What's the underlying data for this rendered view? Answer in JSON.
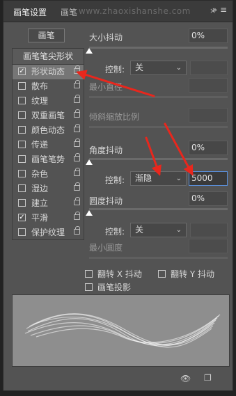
{
  "tabs": [
    {
      "label": "画笔设置",
      "active": true
    },
    {
      "label": "画笔",
      "active": false
    }
  ],
  "title_controls": "»  ≡",
  "tab_close": "×",
  "watermark": "www.zhaoxishanshe.com",
  "brush_button": "画笔",
  "brush_tip_shape": "画笔笔尖形状",
  "options": [
    {
      "label": "形状动态",
      "checked": true,
      "selected": true
    },
    {
      "label": "散布",
      "checked": false
    },
    {
      "label": "纹理",
      "checked": false
    },
    {
      "label": "双重画笔",
      "checked": false
    },
    {
      "label": "颜色动态",
      "checked": false
    },
    {
      "label": "传递",
      "checked": false
    },
    {
      "label": "画笔笔势",
      "checked": false
    },
    {
      "label": "杂色",
      "checked": false
    },
    {
      "label": "湿边",
      "checked": false
    },
    {
      "label": "建立",
      "checked": false
    },
    {
      "label": "平滑",
      "checked": true
    },
    {
      "label": "保护纹理",
      "checked": false
    }
  ],
  "size_jitter": {
    "label": "大小抖动",
    "value": "0%"
  },
  "control1": {
    "label": "控制:",
    "value": "关"
  },
  "min_diameter": {
    "label": "最小直径"
  },
  "tilt_scale": {
    "label": "倾斜缩放比例"
  },
  "angle_jitter": {
    "label": "角度抖动",
    "value": "0%"
  },
  "control2": {
    "label": "控制:",
    "value": "渐隐",
    "steps": "5000"
  },
  "roundness_jitter": {
    "label": "圆度抖动",
    "value": "0%"
  },
  "control3": {
    "label": "控制:",
    "value": "关"
  },
  "min_roundness": {
    "label": "最小圆度"
  },
  "flip_x": {
    "label": "翻转 X 抖动"
  },
  "flip_y": {
    "label": "翻转 Y 抖动"
  },
  "brush_projection": {
    "label": "画笔投影"
  },
  "colors": {
    "arrow": "#e8271d",
    "panel": "#535353"
  }
}
